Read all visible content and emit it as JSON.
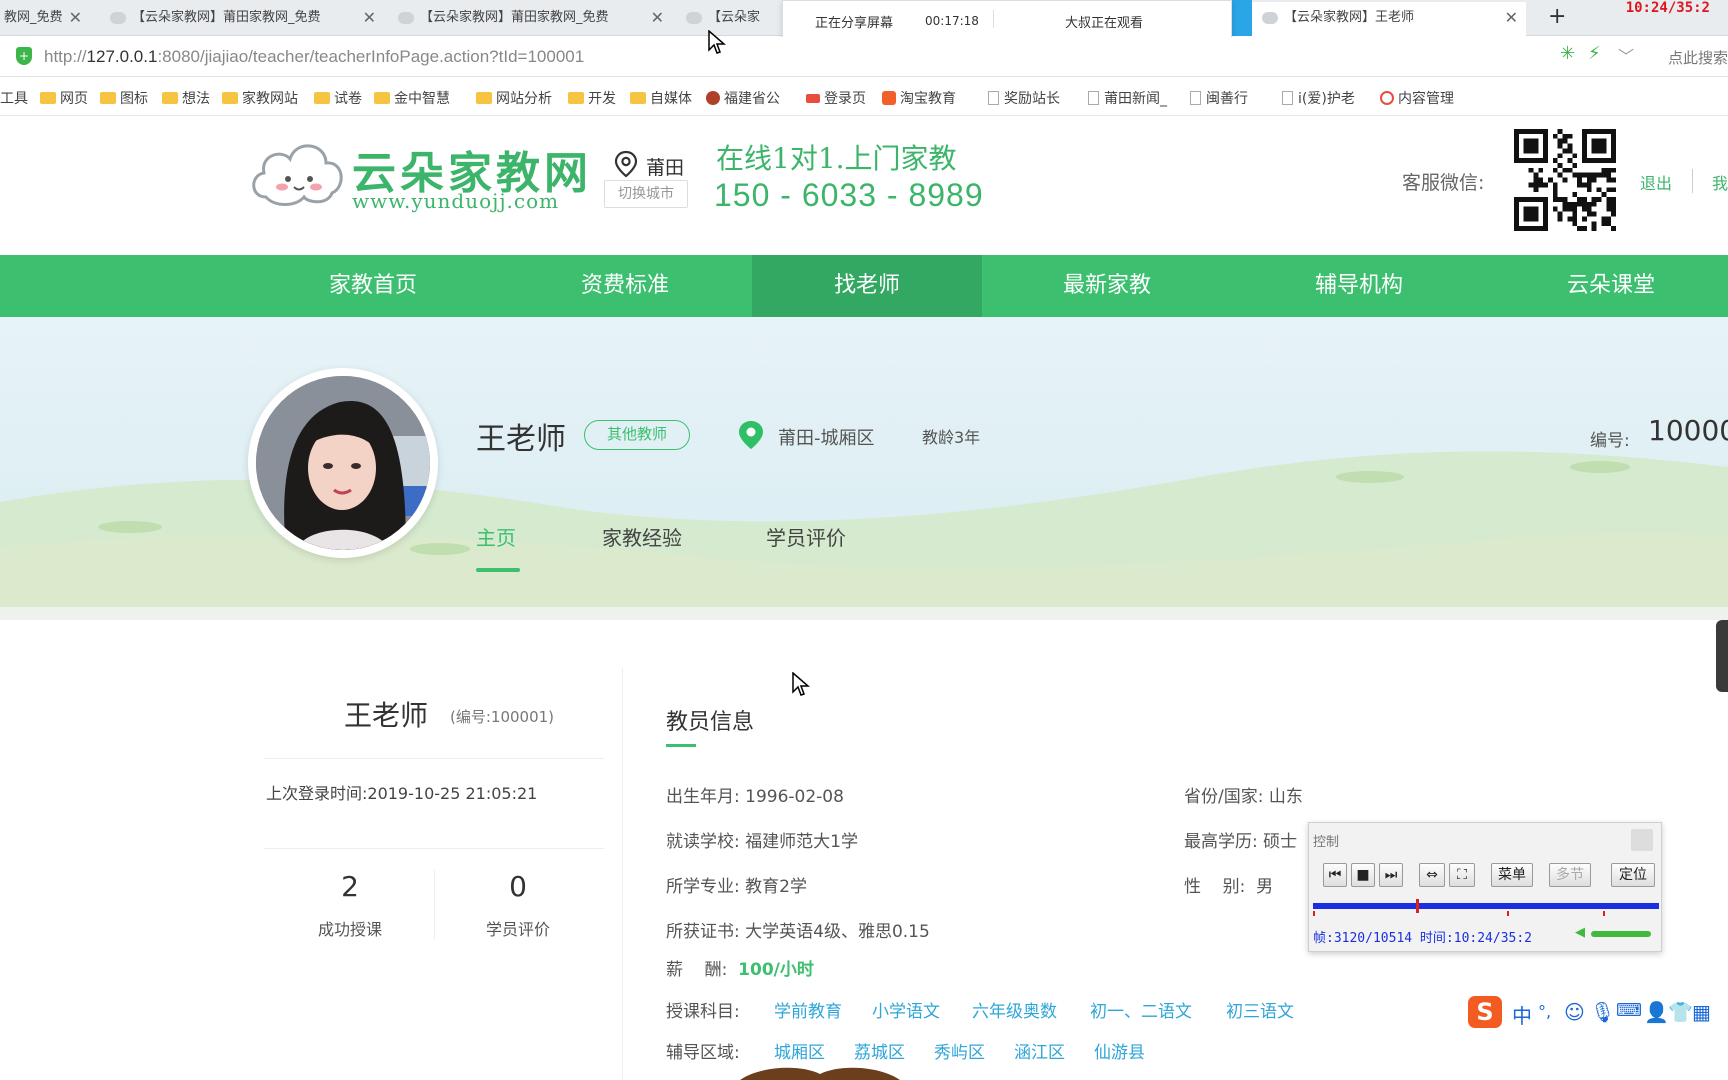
{
  "browser": {
    "tabs": [
      {
        "label": "教网_免费"
      },
      {
        "label": "【云朵家教网】莆田家教网_免费"
      },
      {
        "label": "【云朵家教网】莆田家教网_免费"
      },
      {
        "label": "【云朵家"
      },
      {
        "label": "【云朵家教网】王老师"
      }
    ],
    "new_tab": "+",
    "share_popup": {
      "sharing": "正在分享屏幕",
      "elapsed": "00:17:18",
      "viewer": "大叔正在观看"
    },
    "recording_time": "10:24/35:2",
    "url": {
      "prefix": "http://",
      "host": "127.0.0.1",
      "path": ":8080/jiajiao/teacher/teacherInfoPage.action?tId=100001"
    },
    "search_hint": "点此搜索",
    "bookmarks": [
      "工具",
      "网页",
      "图标",
      "想法",
      "家教网站",
      "试卷",
      "金中智慧",
      "网站分析",
      "开发",
      "自媒体",
      "福建省公",
      "登录页",
      "淘宝教育",
      "奖励站长",
      "莆田新闻_",
      "闽善行",
      "i(爱)护老",
      "内容管理"
    ]
  },
  "header": {
    "logo": "云朵家教网",
    "logo_url": "www.yunduojj.com",
    "city": "莆田",
    "switch_city": "切换城市",
    "slogan": "在线1对1.上门家教",
    "phone": "150 - 6033 - 8989",
    "wechat_label": "客服微信:",
    "logout": "退出",
    "my": "我"
  },
  "nav": [
    {
      "label": "家教首页",
      "active": false
    },
    {
      "label": "资费标准",
      "active": false
    },
    {
      "label": "找老师",
      "active": true
    },
    {
      "label": "最新家教",
      "active": false
    },
    {
      "label": "辅导机构",
      "active": false
    },
    {
      "label": "云朵课堂",
      "active": false
    }
  ],
  "profile": {
    "name": "王老师",
    "tag": "其他教师",
    "location": "莆田-城厢区",
    "experience": "教龄3年",
    "number_label": "编号:",
    "number": "10000",
    "tabs": [
      "主页",
      "家教经验",
      "学员评价"
    ]
  },
  "card": {
    "name": "王老师",
    "number": "(编号:100001)",
    "last_login": "上次登录时间:2019-10-25 21:05:21",
    "stats": [
      {
        "value": "2",
        "label": "成功授课"
      },
      {
        "value": "0",
        "label": "学员评价"
      }
    ]
  },
  "info": {
    "title": "教员信息",
    "birth_label": "出生年月:",
    "birth": "1996-02-08",
    "province_label": "省份/国家:",
    "province": "山东",
    "school_label": "就读学校:",
    "school": "福建师范大1学",
    "education_label": "最高学历:",
    "education": "硕士",
    "major_label": "所学专业:",
    "major": "教育2学",
    "gender_label": "性    别:",
    "gender": "男",
    "cert_label": "所获证书:",
    "cert": "大学英语4级、雅思0.15",
    "salary_label": "薪    酬:",
    "salary": "100/小时",
    "subjects_label": "授课科目:",
    "subjects": [
      "学前教育",
      "小学语文",
      "六年级奥数",
      "初一、二语文",
      "初三语文"
    ],
    "areas_label": "辅导区域:",
    "areas": [
      "城厢区",
      "荔城区",
      "秀屿区",
      "涵江区",
      "仙游县"
    ]
  },
  "player": {
    "title": "控制",
    "menu": "菜单",
    "multi": "多节",
    "locate": "定位",
    "status": "帧:3120/10514 时间:10:24/35:2",
    "progress": 0.297
  },
  "ime": {
    "lang": "中",
    "punct": "°,"
  }
}
